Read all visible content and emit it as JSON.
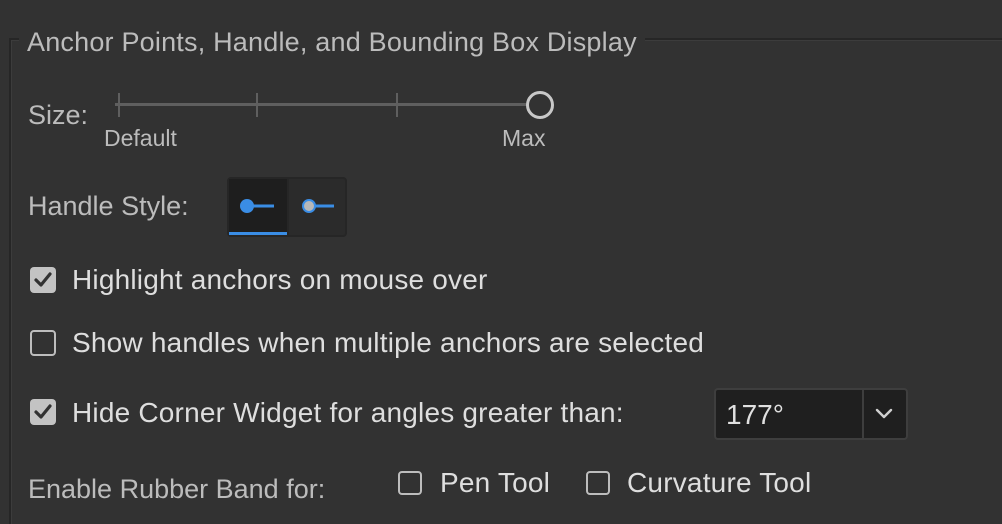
{
  "section": {
    "title": "Anchor Points, Handle, and Bounding Box Display"
  },
  "size": {
    "label": "Size:",
    "min_label": "Default",
    "max_label": "Max",
    "value_fraction": 1.0,
    "tick_count": 4
  },
  "handle_style": {
    "label": "Handle Style:",
    "options": [
      {
        "icon": "solid-handle-icon",
        "selected": true
      },
      {
        "icon": "hollow-handle-icon",
        "selected": false
      }
    ]
  },
  "options": {
    "highlight_anchors": {
      "label": "Highlight anchors on mouse over",
      "checked": true
    },
    "show_handles_multiple": {
      "label": "Show handles when multiple anchors are selected",
      "checked": false
    },
    "hide_corner_widget": {
      "label": "Hide Corner Widget for angles greater than:",
      "checked": true,
      "value": "177°"
    }
  },
  "rubber_band": {
    "label": "Enable Rubber Band for:",
    "pen_tool": {
      "label": "Pen Tool",
      "checked": false
    },
    "curvature_tool": {
      "label": "Curvature Tool",
      "checked": false
    }
  },
  "colors": {
    "accent": "#3a8de5",
    "background": "#323232"
  }
}
